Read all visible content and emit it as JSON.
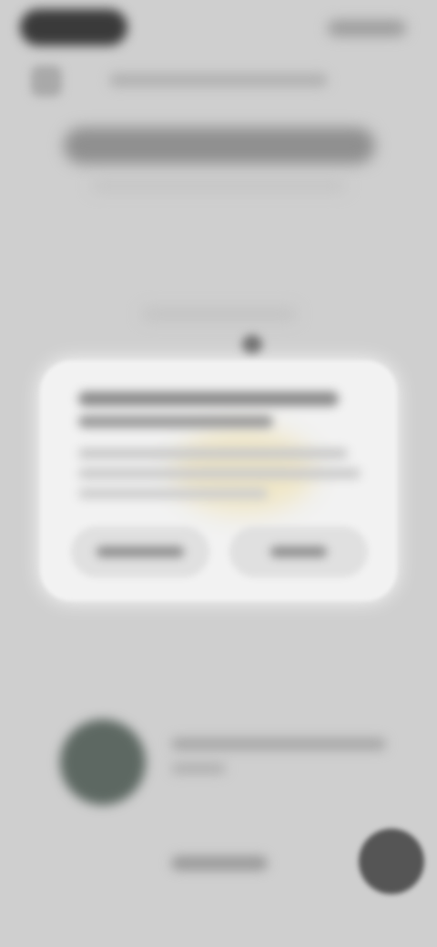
{
  "screen": {
    "background": "#cfcfcf"
  },
  "status_bar": {},
  "header": {},
  "dialog": {
    "background": "#f2f2f2"
  },
  "promo": {},
  "fab": {
    "color": "#555555"
  }
}
